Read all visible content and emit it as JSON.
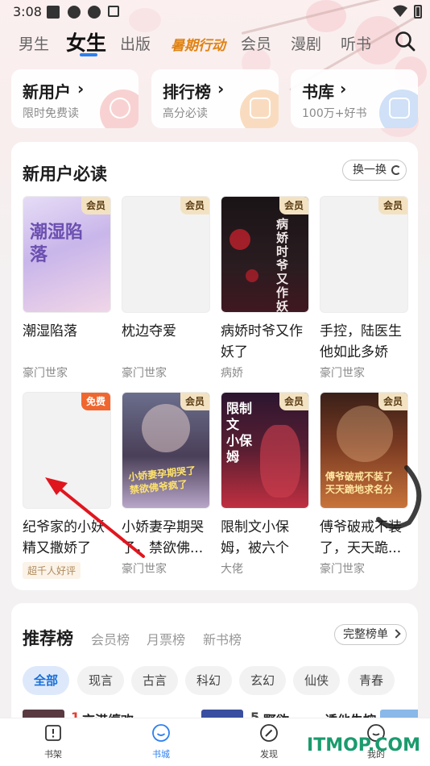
{
  "status": {
    "time": "3:08"
  },
  "tabs": [
    {
      "label": "男生",
      "active": false
    },
    {
      "label": "女生",
      "active": true
    },
    {
      "label": "出版",
      "active": false
    },
    {
      "label": "暑期行动",
      "active": false
    },
    {
      "label": "会员",
      "active": false
    },
    {
      "label": "漫剧",
      "active": false
    },
    {
      "label": "听书",
      "active": false
    }
  ],
  "quick_entries": [
    {
      "title": "新用户",
      "sub": "限时免费读",
      "icon": "alarm-clock-icon",
      "color": "#f5c6c6"
    },
    {
      "title": "排行榜",
      "sub": "高分必读",
      "icon": "podium-icon",
      "color": "#f7d8b6"
    },
    {
      "title": "书库",
      "sub": "100万+好书",
      "icon": "book-stack-icon",
      "color": "#c7dcf6"
    }
  ],
  "new_user": {
    "title": "新用户必读",
    "refresh_label": "换一换",
    "books": [
      {
        "title": "潮湿陷落",
        "tag": "豪门世家",
        "badge": "会员",
        "badge_type": "vip",
        "cover_text": "潮湿陷落"
      },
      {
        "title": "枕边夺爱",
        "tag": "豪门世家",
        "badge": "会员",
        "badge_type": "vip",
        "cover_text": ""
      },
      {
        "title": "病娇时爷又作妖了",
        "tag": "病娇",
        "badge": "会员",
        "badge_type": "vip",
        "cover_text": "病娇时爷又作妖了"
      },
      {
        "title": "手控，陆医生他如此多娇",
        "tag": "豪门世家",
        "badge": "会员",
        "badge_type": "vip",
        "cover_text": ""
      },
      {
        "title": "纪爷家的小妖精又撒娇了",
        "tag": "",
        "pill": "超千人好评",
        "badge": "免费",
        "badge_type": "free",
        "cover_text": ""
      },
      {
        "title": "小娇妻孕期哭了，禁欲佛...",
        "tag": "豪门世家",
        "badge": "会员",
        "badge_type": "vip",
        "cover_text": "小娇妻孕期哭了 禁欲佛爷疯了"
      },
      {
        "title": "限制文小保姆，被六个大...",
        "tag": "大佬",
        "badge": "会员",
        "badge_type": "vip",
        "cover_text": "限制文 小保姆"
      },
      {
        "title": "傅爷破戒不装了，天天跪...",
        "tag": "豪门世家",
        "badge": "会员",
        "badge_type": "vip",
        "cover_text": "傅爷破戒不装了 天天跪地求名分"
      }
    ]
  },
  "ranking": {
    "title": "推荐榜",
    "tabs": [
      "会员榜",
      "月票榜",
      "新书榜"
    ],
    "full_label": "完整榜单",
    "chips": [
      "全部",
      "现言",
      "古言",
      "科幻",
      "玄幻",
      "仙侠",
      "青春"
    ],
    "peek": [
      {
        "rank": "1",
        "text": "京港缠欢"
      },
      {
        "rank": "5",
        "text": "野欲"
      },
      {
        "rank": "",
        "text": "诱他失控"
      }
    ]
  },
  "bottom_nav": [
    {
      "label": "书架",
      "active": false
    },
    {
      "label": "书城",
      "active": true
    },
    {
      "label": "发现",
      "active": false
    },
    {
      "label": "我的",
      "active": false
    }
  ],
  "watermark": "ITMOP.COM"
}
